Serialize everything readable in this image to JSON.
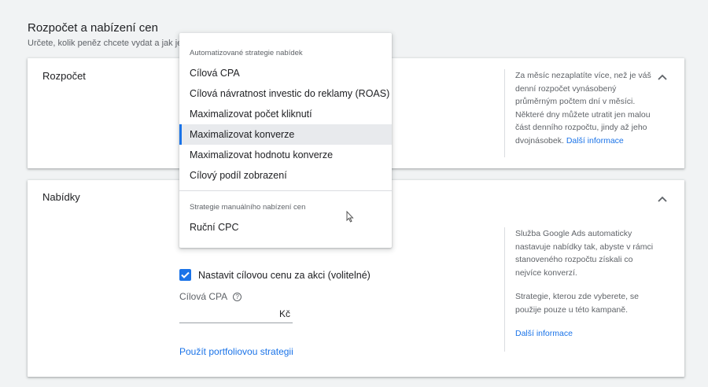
{
  "header": {
    "title": "Rozpočet a nabízení cen",
    "subtitle": "Určete, kolik peněz chcete vydat a jak je c"
  },
  "budget_card": {
    "title": "Rozpočet",
    "help": "Za měsíc nezaplatíte více, než je váš denní rozpočet vynásobený průměrným počtem dní v měsíci. Některé dny můžete utratit jen malou část denního rozpočtu, jindy až jeho dvojnásobek.",
    "help_link": "Další informace",
    "chevron_icon": "chevron-up-icon"
  },
  "bids_card": {
    "title": "Nabídky",
    "checkbox_label": "Nastavit cílovou cenu za akci (volitelné)",
    "checkbox_checked": true,
    "cpa_label": "Cílová CPA",
    "cpa_help_icon": "help-circle-icon",
    "cpa_value": "",
    "currency_suffix": "Kč",
    "portfolio_link": "Použít portfoliovou strategii",
    "help_p1": "Služba Google Ads automaticky nastavuje nabídky tak, abyste v rámci stanoveného rozpočtu získali co nejvíce konverzí.",
    "help_p2": "Strategie, kterou zde vyberete, se použije pouze u této kampaně.",
    "help_link": "Další informace",
    "chevron_icon": "chevron-up-icon"
  },
  "dropdown": {
    "automated_heading": "Automatizované strategie nabídek",
    "automated_items": [
      "Cílová CPA",
      "Cílová návratnost investic do reklamy (ROAS)",
      "Maximalizovat počet kliknutí",
      "Maximalizovat konverze",
      "Maximalizovat hodnotu konverze",
      "Cílový podíl zobrazení"
    ],
    "selected_item": "Maximalizovat konverze",
    "manual_heading": "Strategie manuálního nabízení cen",
    "manual_items": [
      "Ruční CPC"
    ]
  },
  "colors": {
    "accent": "#1a73e8",
    "selected_bg": "#e8eaed",
    "page_bg": "#f1f3f4"
  }
}
